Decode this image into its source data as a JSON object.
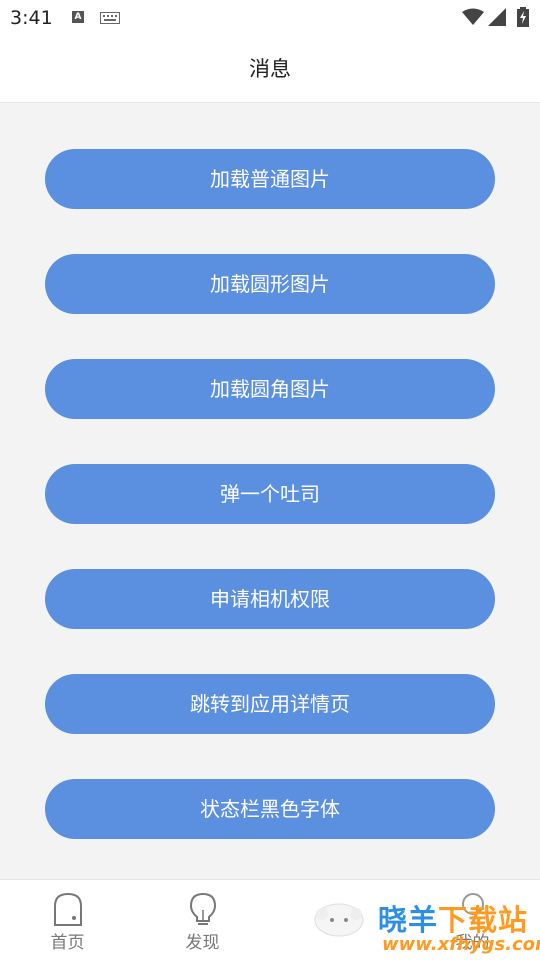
{
  "status_bar": {
    "time": "3:41",
    "notification_icon": "A"
  },
  "header": {
    "title": "消息"
  },
  "buttons": [
    {
      "label": "加载普通图片"
    },
    {
      "label": "加载圆形图片"
    },
    {
      "label": "加载圆角图片"
    },
    {
      "label": "弹一个吐司"
    },
    {
      "label": "申请相机权限"
    },
    {
      "label": "跳转到应用详情页"
    },
    {
      "label": "状态栏黑色字体"
    }
  ],
  "tabs": [
    {
      "label": "首页",
      "icon": "home-icon"
    },
    {
      "label": "发现",
      "icon": "bulb-icon"
    },
    {
      "label": "",
      "icon": ""
    },
    {
      "label": "我的",
      "icon": "user-icon"
    }
  ],
  "watermark": {
    "brand_a": "晓羊",
    "brand_b": "下载站",
    "url": "www.xfhygs.com"
  },
  "colors": {
    "accent": "#5b8fdf",
    "background": "#f3f3f3"
  }
}
